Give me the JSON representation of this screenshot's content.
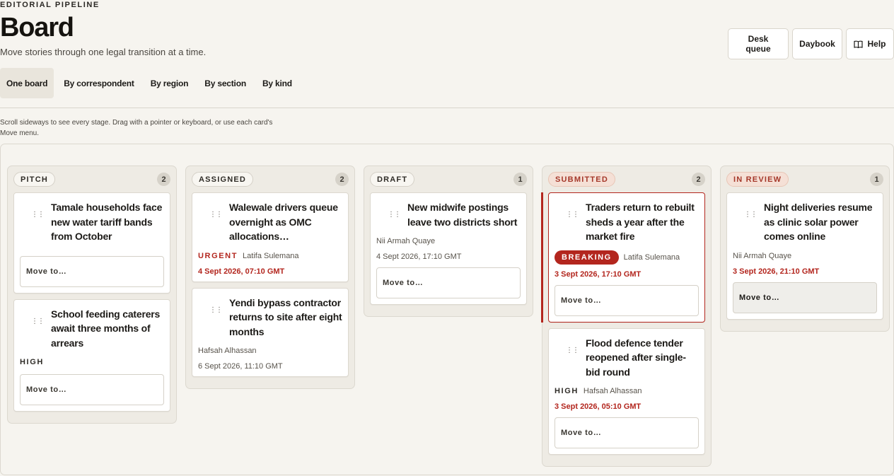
{
  "header": {
    "eyebrow": "EDITORIAL PIPELINE",
    "title": "Board",
    "subtitle": "Move stories through one legal transition at a time."
  },
  "actions": {
    "desk_queue": "Desk queue",
    "daybook": "Daybook",
    "help": "Help"
  },
  "tabs": [
    {
      "label": "One board",
      "active": true
    },
    {
      "label": "By correspondent"
    },
    {
      "label": "By region"
    },
    {
      "label": "By section"
    },
    {
      "label": "By kind"
    }
  ],
  "hint": "Scroll sideways to see every stage. Drag with a pointer or keyboard, or use each card's Move menu.",
  "move_label": "Move to…",
  "colors": {
    "accent_red": "#b3261e",
    "background": "#f6f4ef",
    "column_bg": "#eeebe4"
  },
  "columns": [
    {
      "name": "PITCH",
      "count": "2",
      "cards": [
        {
          "title": "Tamale households face new water tariff bands from October"
        },
        {
          "title": "School feeding caterers await three months of arrears",
          "priority": "HIGH"
        }
      ]
    },
    {
      "name": "ASSIGNED",
      "count": "2",
      "cards": [
        {
          "title": "Walewale drivers queue overnight as OMC allocations…",
          "priority": "URGENT",
          "byline": "Latifa Sulemana",
          "timestamp": "4 Sept 2026, 07:10 GMT"
        },
        {
          "title": "Yendi bypass contractor returns to site after eight months",
          "byline": "Hafsah Alhassan",
          "timestamp": "6 Sept 2026, 11:10 GMT"
        }
      ]
    },
    {
      "name": "DRAFT",
      "count": "1",
      "cards": [
        {
          "title": "New midwife postings leave two districts short",
          "byline": "Nii Armah Quaye",
          "timestamp": "4 Sept 2026, 17:10 GMT"
        }
      ]
    },
    {
      "name": "SUBMITTED",
      "count": "2",
      "cards": [
        {
          "title": "Traders return to rebuilt sheds a year after the market fire",
          "priority": "BREAKING",
          "byline": "Latifa Sulemana",
          "timestamp": "3 Sept 2026, 17:10 GMT"
        },
        {
          "title": "Flood defence tender reopened after single-bid round",
          "priority": "HIGH",
          "byline": "Hafsah Alhassan",
          "timestamp": "3 Sept 2026, 05:10 GMT"
        }
      ]
    },
    {
      "name": "IN REVIEW",
      "count": "1",
      "cards": [
        {
          "title": "Night deliveries resume as clinic solar power comes online",
          "byline": "Nii Armah Quaye",
          "timestamp": "3 Sept 2026, 21:10 GMT"
        }
      ]
    }
  ]
}
